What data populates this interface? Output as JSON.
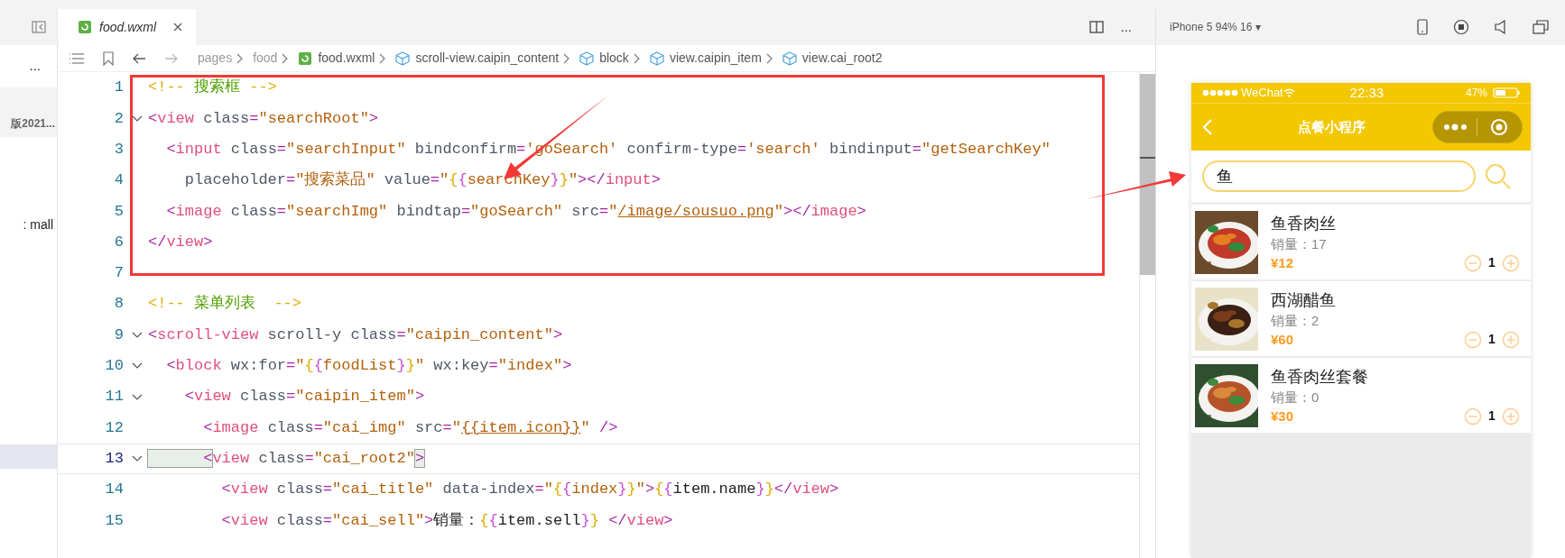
{
  "sidebar": {
    "more": "...",
    "items": [
      {
        "kind": "header",
        "label": "版2021..."
      },
      {
        "kind": "item",
        "label": ": mall",
        "selected": false
      },
      {
        "kind": "item",
        "selected": true
      }
    ]
  },
  "editor": {
    "tabs": [
      {
        "label": "food.wxml",
        "selected": true
      }
    ],
    "more": "...",
    "breadcrumb": [
      {
        "kind": "folder",
        "label": "pages"
      },
      {
        "kind": "folder",
        "label": "food"
      },
      {
        "kind": "file",
        "label": "food.wxml"
      },
      {
        "kind": "node",
        "label": "scroll-view.caipin_content"
      },
      {
        "kind": "node",
        "label": "block"
      },
      {
        "kind": "node",
        "label": "view.caipin_item"
      },
      {
        "kind": "node",
        "label": "view.cai_root2"
      }
    ],
    "lines": [
      {
        "number": "1",
        "foldable": false,
        "current": false,
        "tokens": [
          {
            "kind": "cmt-mark",
            "text": "<!-- "
          },
          {
            "kind": "cmt",
            "text": "搜索框"
          },
          {
            "kind": "cmt-mark",
            "text": " -->"
          }
        ]
      },
      {
        "number": "2",
        "foldable": true,
        "current": false,
        "tokens": [
          {
            "kind": "punct",
            "text": "<"
          },
          {
            "kind": "tag",
            "text": "view"
          },
          {
            "kind": "attr",
            "text": " class"
          },
          {
            "kind": "punct",
            "text": "="
          },
          {
            "kind": "str",
            "text": "\"searchRoot\""
          },
          {
            "kind": "punct",
            "text": ">"
          }
        ]
      },
      {
        "number": "3",
        "foldable": false,
        "current": false,
        "tokens": [
          {
            "kind": "punct",
            "text": "  <"
          },
          {
            "kind": "tag",
            "text": "input"
          },
          {
            "kind": "attr",
            "text": " class"
          },
          {
            "kind": "punct",
            "text": "="
          },
          {
            "kind": "str",
            "text": "\"searchInput\""
          },
          {
            "kind": "attr",
            "text": " bindconfirm"
          },
          {
            "kind": "punct",
            "text": "="
          },
          {
            "kind": "str",
            "text": "'goSearch'"
          },
          {
            "kind": "attr",
            "text": " confirm-type"
          },
          {
            "kind": "punct",
            "text": "="
          },
          {
            "kind": "str",
            "text": "'search'"
          },
          {
            "kind": "attr",
            "text": " bindinput"
          },
          {
            "kind": "punct",
            "text": "="
          },
          {
            "kind": "str",
            "text": "\"getSearchKey\""
          }
        ]
      },
      {
        "number": "4",
        "foldable": false,
        "current": false,
        "tokens": [
          {
            "kind": "attr",
            "text": "    placeholder"
          },
          {
            "kind": "punct",
            "text": "="
          },
          {
            "kind": "str",
            "text": "\"搜索菜品\""
          },
          {
            "kind": "attr",
            "text": " value"
          },
          {
            "kind": "punct",
            "text": "="
          },
          {
            "kind": "str",
            "text": "\""
          },
          {
            "kind": "brace",
            "text": "{"
          },
          {
            "kind": "brace2",
            "text": "{"
          },
          {
            "kind": "str",
            "text": "searchKey"
          },
          {
            "kind": "brace2",
            "text": "}"
          },
          {
            "kind": "brace",
            "text": "}"
          },
          {
            "kind": "str",
            "text": "\""
          },
          {
            "kind": "punct",
            "text": "></"
          },
          {
            "kind": "tag",
            "text": "input"
          },
          {
            "kind": "punct",
            "text": ">"
          }
        ]
      },
      {
        "number": "5",
        "foldable": false,
        "current": false,
        "tokens": [
          {
            "kind": "punct",
            "text": "  <"
          },
          {
            "kind": "tag",
            "text": "image"
          },
          {
            "kind": "attr",
            "text": " class"
          },
          {
            "kind": "punct",
            "text": "="
          },
          {
            "kind": "str",
            "text": "\"searchImg\""
          },
          {
            "kind": "attr",
            "text": " bindtap"
          },
          {
            "kind": "punct",
            "text": "="
          },
          {
            "kind": "str",
            "text": "\"goSearch\""
          },
          {
            "kind": "attr",
            "text": " src"
          },
          {
            "kind": "punct",
            "text": "="
          },
          {
            "kind": "str",
            "text": "\""
          },
          {
            "kind": "link",
            "text": "/image/sousuo.png"
          },
          {
            "kind": "str",
            "text": "\""
          },
          {
            "kind": "punct",
            "text": "></"
          },
          {
            "kind": "tag",
            "text": "image"
          },
          {
            "kind": "punct",
            "text": ">"
          }
        ]
      },
      {
        "number": "6",
        "foldable": false,
        "current": false,
        "tokens": [
          {
            "kind": "punct",
            "text": "</"
          },
          {
            "kind": "tag",
            "text": "view"
          },
          {
            "kind": "punct",
            "text": ">"
          }
        ]
      },
      {
        "number": "7",
        "foldable": false,
        "current": false
      },
      {
        "number": "8",
        "foldable": false,
        "current": false,
        "tokens": [
          {
            "kind": "cmt-mark",
            "text": "<!-- "
          },
          {
            "kind": "cmt",
            "text": "菜单列表"
          },
          {
            "kind": "cmt-mark",
            "text": "  -->"
          }
        ]
      },
      {
        "number": "9",
        "foldable": true,
        "current": false,
        "tokens": [
          {
            "kind": "punct",
            "text": "<"
          },
          {
            "kind": "tag",
            "text": "scroll-view"
          },
          {
            "kind": "attr",
            "text": " scroll-y class"
          },
          {
            "kind": "punct",
            "text": "="
          },
          {
            "kind": "str",
            "text": "\"caipin_content\""
          },
          {
            "kind": "punct",
            "text": ">"
          }
        ]
      },
      {
        "number": "10",
        "foldable": true,
        "current": false,
        "tokens": [
          {
            "kind": "punct",
            "text": "  <"
          },
          {
            "kind": "tag",
            "text": "block"
          },
          {
            "kind": "attr",
            "text": " wx:for"
          },
          {
            "kind": "punct",
            "text": "="
          },
          {
            "kind": "str",
            "text": "\""
          },
          {
            "kind": "brace",
            "text": "{"
          },
          {
            "kind": "brace2",
            "text": "{"
          },
          {
            "kind": "str",
            "text": "foodList"
          },
          {
            "kind": "brace2",
            "text": "}"
          },
          {
            "kind": "brace",
            "text": "}"
          },
          {
            "kind": "str",
            "text": "\""
          },
          {
            "kind": "attr",
            "text": " wx:key"
          },
          {
            "kind": "punct",
            "text": "="
          },
          {
            "kind": "str",
            "text": "\"index\""
          },
          {
            "kind": "punct",
            "text": ">"
          }
        ]
      },
      {
        "number": "11",
        "foldable": true,
        "current": false,
        "tokens": [
          {
            "kind": "punct",
            "text": "    <"
          },
          {
            "kind": "tag",
            "text": "view"
          },
          {
            "kind": "attr",
            "text": " class"
          },
          {
            "kind": "punct",
            "text": "="
          },
          {
            "kind": "str",
            "text": "\"caipin_item\""
          },
          {
            "kind": "punct",
            "text": ">"
          }
        ]
      },
      {
        "number": "12",
        "foldable": false,
        "current": false,
        "tokens": [
          {
            "kind": "punct",
            "text": "      <"
          },
          {
            "kind": "tag",
            "text": "image"
          },
          {
            "kind": "attr",
            "text": " class"
          },
          {
            "kind": "punct",
            "text": "="
          },
          {
            "kind": "str",
            "text": "\"cai_img\""
          },
          {
            "kind": "attr",
            "text": " src"
          },
          {
            "kind": "punct",
            "text": "="
          },
          {
            "kind": "str",
            "text": "\""
          },
          {
            "kind": "link",
            "text": "{{item.icon}}"
          },
          {
            "kind": "str",
            "text": "\""
          },
          {
            "kind": "punct",
            "text": " />"
          }
        ]
      },
      {
        "number": "13",
        "foldable": true,
        "current": true,
        "tokens": [
          {
            "kind": "match",
            "text": "      <"
          },
          {
            "kind": "tag",
            "text": "view"
          },
          {
            "kind": "attr",
            "text": " class"
          },
          {
            "kind": "punct",
            "text": "="
          },
          {
            "kind": "str",
            "text": "\"cai_root2\""
          },
          {
            "kind": "match",
            "text": ">"
          }
        ]
      },
      {
        "number": "14",
        "foldable": false,
        "current": false,
        "tokens": [
          {
            "kind": "punct",
            "text": "        <"
          },
          {
            "kind": "tag",
            "text": "view"
          },
          {
            "kind": "attr",
            "text": " class"
          },
          {
            "kind": "punct",
            "text": "="
          },
          {
            "kind": "str",
            "text": "\"cai_title\""
          },
          {
            "kind": "attr",
            "text": " data-index"
          },
          {
            "kind": "punct",
            "text": "="
          },
          {
            "kind": "str",
            "text": "\""
          },
          {
            "kind": "brace",
            "text": "{"
          },
          {
            "kind": "brace2",
            "text": "{"
          },
          {
            "kind": "str",
            "text": "index"
          },
          {
            "kind": "brace2",
            "text": "}"
          },
          {
            "kind": "brace",
            "text": "}"
          },
          {
            "kind": "str",
            "text": "\""
          },
          {
            "kind": "punct",
            "text": ">"
          },
          {
            "kind": "brace",
            "text": "{"
          },
          {
            "kind": "brace2",
            "text": "{"
          },
          {
            "kind": "text",
            "text": "item.name"
          },
          {
            "kind": "brace2",
            "text": "}"
          },
          {
            "kind": "brace",
            "text": "}"
          },
          {
            "kind": "punct",
            "text": "</"
          },
          {
            "kind": "tag",
            "text": "view"
          },
          {
            "kind": "punct",
            "text": ">"
          }
        ]
      },
      {
        "number": "15",
        "foldable": false,
        "current": false,
        "tokens": [
          {
            "kind": "punct",
            "text": "        <"
          },
          {
            "kind": "tag",
            "text": "view"
          },
          {
            "kind": "attr",
            "text": " class"
          },
          {
            "kind": "punct",
            "text": "="
          },
          {
            "kind": "str",
            "text": "\"cai_sell\""
          },
          {
            "kind": "punct",
            "text": ">"
          },
          {
            "kind": "text",
            "text": "销量："
          },
          {
            "kind": "brace",
            "text": "{"
          },
          {
            "kind": "brace2",
            "text": "{"
          },
          {
            "kind": "text",
            "text": "item.sell"
          },
          {
            "kind": "brace2",
            "text": "}"
          },
          {
            "kind": "brace",
            "text": "}"
          },
          {
            "kind": "punct",
            "text": " </"
          },
          {
            "kind": "tag",
            "text": "view"
          },
          {
            "kind": "punct",
            "text": ">"
          }
        ]
      }
    ]
  },
  "simulator": {
    "device": "iPhone 5 94% 16 ▾",
    "status_bar": {
      "carrier": "WeChat",
      "time": "22:33",
      "battery": "47%"
    },
    "nav_title": "点餐小程序",
    "search": {
      "value": "鱼"
    },
    "items": [
      {
        "name": "鱼香肉丝",
        "sales": "销量：17",
        "price": "¥12",
        "quantity": "1"
      },
      {
        "name": "西湖醋鱼",
        "sales": "销量：2",
        "price": "¥60",
        "quantity": "1"
      },
      {
        "name": "鱼香肉丝套餐",
        "sales": "销量：0",
        "price": "¥30",
        "quantity": "1"
      }
    ]
  }
}
